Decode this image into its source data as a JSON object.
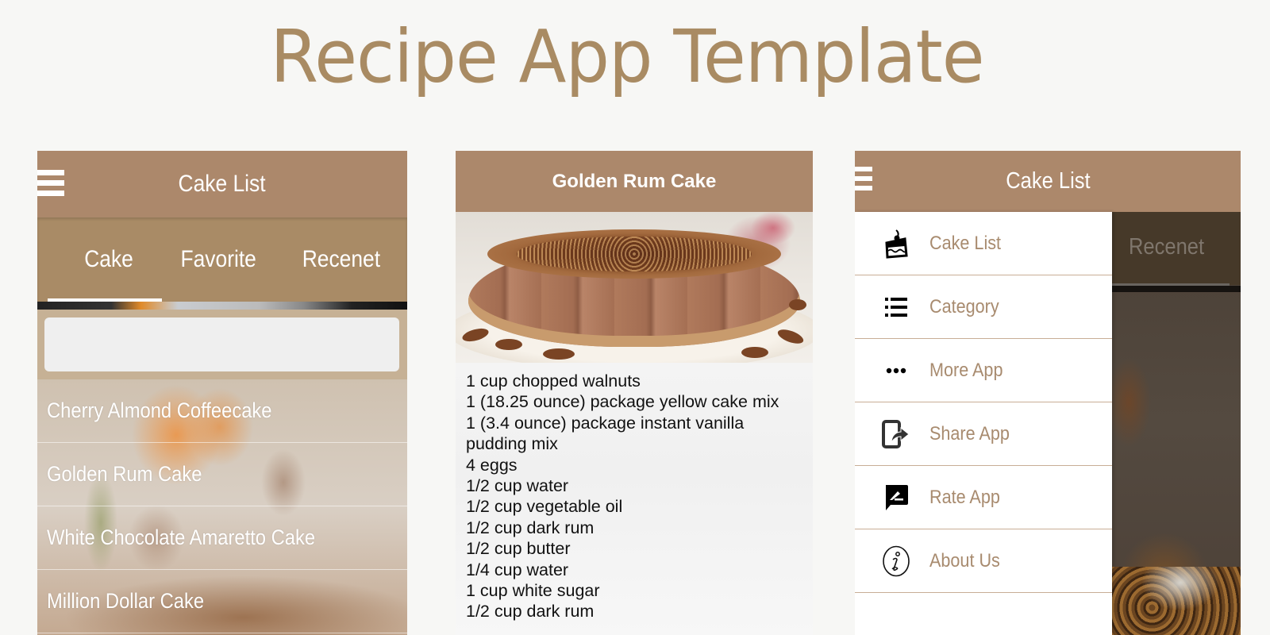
{
  "page": {
    "title": "Recipe App Template"
  },
  "screen_list": {
    "appbar_title": "Cake List",
    "menu_icon": "hamburger-menu-icon",
    "tabs": [
      {
        "label": "Cake",
        "active": true
      },
      {
        "label": "Favorite",
        "active": false
      },
      {
        "label": "Recenet",
        "active": false
      }
    ],
    "search": {
      "value": "",
      "placeholder": ""
    },
    "cakes": [
      "Cherry Almond Coffeecake",
      "Golden Rum Cake",
      "White Chocolate Amaretto Cake",
      "Million Dollar Cake"
    ]
  },
  "screen_detail": {
    "title": "Golden Rum Cake",
    "image": "golden-rum-cake-photo",
    "ingredients": [
      "1 cup chopped walnuts",
      "1 (18.25 ounce) package yellow cake mix",
      "1 (3.4 ounce) package instant vanilla",
      "pudding mix",
      "4 eggs",
      "1/2 cup water",
      "1/2 cup vegetable oil",
      "1/2 cup dark rum",
      "1/2 cup butter",
      "1/4 cup water",
      "1 cup white sugar",
      "1/2 cup dark rum"
    ]
  },
  "screen_drawer": {
    "appbar_title": "Cake List",
    "behind_tab_label": "Recenet",
    "menu": [
      {
        "label": "Cake List",
        "icon": "cake-icon"
      },
      {
        "label": "Category",
        "icon": "list-icon"
      },
      {
        "label": "More App",
        "icon": "more-dots-icon"
      },
      {
        "label": "Share App",
        "icon": "share-icon"
      },
      {
        "label": "Rate App",
        "icon": "rate-icon"
      },
      {
        "label": "About Us",
        "icon": "info-icon"
      }
    ]
  },
  "colors": {
    "brand": "#ac886b",
    "tab_bar": "#a98b66",
    "title": "#a98b63",
    "drawer_text": "#a88b6f",
    "divider": "#c8ae96"
  }
}
